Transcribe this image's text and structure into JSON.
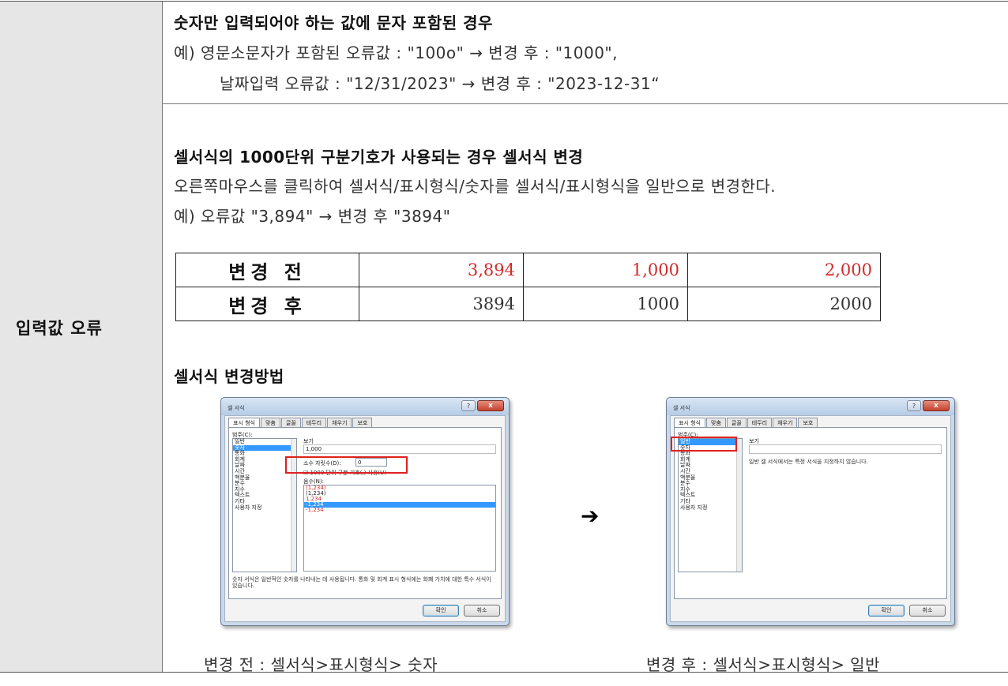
{
  "section_label": "입력값 오류",
  "row1": {
    "heading": "숫자만 입력되어야 하는 값에 문자 포함된 경우",
    "example_line1": "예) 영문소문자가 포함된 오류값 : \"100o\" → 변경 후 : \"1000\",",
    "example_line2": "날짜입력 오류값 : \"12/31/2023\" → 변경 후 : \"2023-12-31“"
  },
  "row2": {
    "heading": "셀서식의 1000단위 구분기호가 사용되는 경우 셀서식 변경",
    "instruction": "오른쪽마우스를 클릭하여 셀서식/표시형식/숫자를 셀서식/표시형식을 일반으로 변경한다.",
    "example": "예) 오류값 \"3,894\" → 변경 후 \"3894\"",
    "table": {
      "before_label": "변경 전",
      "after_label": "변경 후",
      "before_values": [
        "3,894",
        "1,000",
        "2,000"
      ],
      "after_values": [
        "3894",
        "1000",
        "2000"
      ]
    },
    "method_heading": "셀서식 변경방법",
    "arrow": "➔",
    "caption_before": "변경 전 : 셀서식>표시형식> 숫자",
    "caption_after": "변경 후 : 셀서식>표시형식> 일반"
  },
  "dialog": {
    "title": "셀 서식",
    "help": "?",
    "close": "x",
    "tabs": [
      "표시 형식",
      "맞춤",
      "글꼴",
      "테두리",
      "채우기",
      "보호"
    ],
    "category_label": "범주(C):",
    "categories": [
      "일반",
      "숫자",
      "통화",
      "회계",
      "날짜",
      "시간",
      "백분율",
      "분수",
      "지수",
      "텍스트",
      "기타",
      "사용자 지정"
    ],
    "sample_label": "보기",
    "ok": "확인",
    "cancel": "취소"
  },
  "dialog_before": {
    "selected_category": "숫자",
    "sample_value": "1,000",
    "decimal_label": "소수 자릿수(D):",
    "decimal_value": "0",
    "separator_label": "☑ 1000 단위 구분 기호(,) 사용(U)",
    "negative_label": "음수(N):",
    "negative_options": [
      "(1,234)",
      "(1,234)",
      "1,234",
      "-1,234",
      "-1,234"
    ],
    "description": "숫자 서식은 일반적인 숫자를 나타내는 데 사용됩니다. 통화 및 회계 표시 형식에는 화폐 가치에 대한 특수 서식이 있습니다."
  },
  "dialog_after": {
    "selected_category": "일반",
    "sample_value": "",
    "description": "일반 셀 서식에서는 특정 서식을 지정하지 않습니다."
  }
}
